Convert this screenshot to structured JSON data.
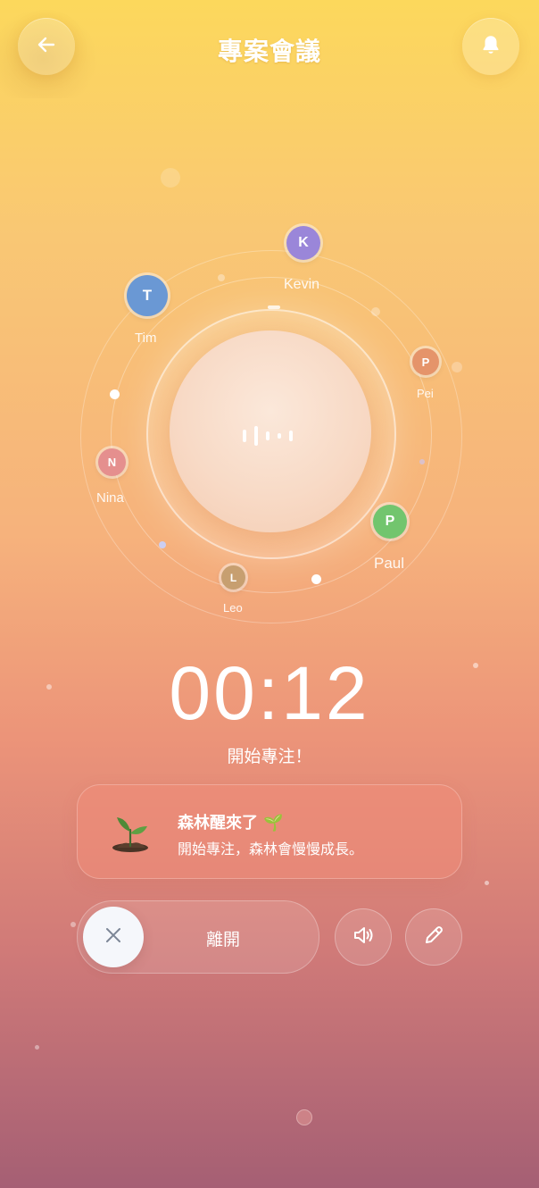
{
  "header": {
    "title": "專案會議",
    "back_icon": "arrow-left-icon",
    "bell_icon": "bell-icon"
  },
  "participants": [
    {
      "initial": "K",
      "name": "Kevin",
      "color": "#9a86d9"
    },
    {
      "initial": "T",
      "name": "Tim",
      "color": "#6a98d4"
    },
    {
      "initial": "P",
      "name": "Pei",
      "color": "#e5946a"
    },
    {
      "initial": "N",
      "name": "Nina",
      "color": "#e58f8e"
    },
    {
      "initial": "P",
      "name": "Paul",
      "color": "#72c56e"
    },
    {
      "initial": "L",
      "name": "Leo",
      "color": "#c79f70"
    }
  ],
  "timer": {
    "value": "00:12",
    "status": "開始專注！"
  },
  "message": {
    "title": "森林醒來了 🌱",
    "body": "開始專注，森林會慢慢成長。",
    "icon": "sprout-icon"
  },
  "controls": {
    "leave_label": "離開",
    "close_icon": "close-icon",
    "volume_icon": "volume-icon",
    "edit_icon": "pencil-icon"
  }
}
